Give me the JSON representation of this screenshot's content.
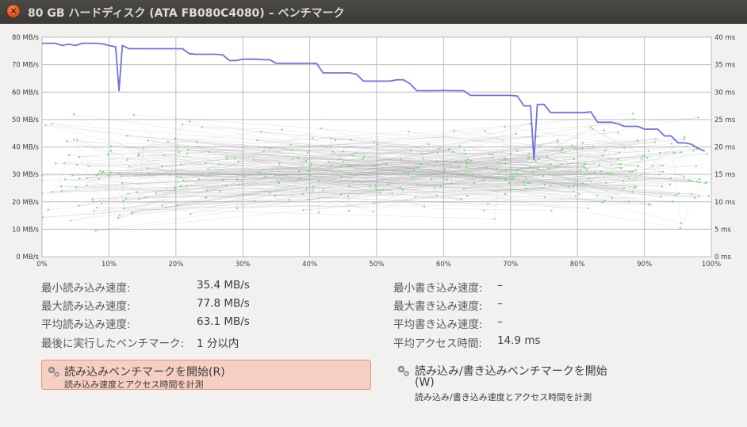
{
  "window": {
    "title": "80 GB ハードディスク (ATA FB080C4080) – ベンチマーク",
    "close_icon": "×"
  },
  "chart_data": {
    "type": "line",
    "y_left_ticks": [
      "0 MB/s",
      "10 MB/s",
      "20 MB/s",
      "30 MB/s",
      "40 MB/s",
      "50 MB/s",
      "60 MB/s",
      "70 MB/s",
      "80 MB/s"
    ],
    "y_right_ticks": [
      "0 ms",
      "5 ms",
      "10 ms",
      "15 ms",
      "20 ms",
      "25 ms",
      "30 ms",
      "35 ms",
      "40 ms"
    ],
    "x_ticks": [
      "0%",
      "10%",
      "20%",
      "30%",
      "40%",
      "50%",
      "60%",
      "70%",
      "80%",
      "90%",
      "100%"
    ],
    "ylim_left": [
      0,
      80
    ],
    "ylim_right": [
      0,
      40
    ],
    "xlim": [
      0,
      100
    ],
    "grid": true,
    "read_rate_color": "#7070e0",
    "access_time_color": "#6ee06e",
    "series": [
      {
        "values_x": [
          0,
          2,
          3,
          4,
          5,
          6,
          7,
          8,
          9,
          10,
          11,
          11.5,
          12,
          13,
          14,
          15,
          16,
          17,
          18,
          19,
          20,
          21,
          22,
          23,
          24,
          25,
          26,
          27,
          28,
          29,
          30,
          31,
          32,
          33,
          34,
          35,
          36,
          37,
          38,
          39,
          40,
          41,
          42,
          43,
          44,
          45,
          46,
          47,
          48,
          49,
          50,
          51,
          52,
          53,
          54,
          55,
          56,
          57,
          58,
          59,
          60,
          61,
          62,
          63,
          64,
          65,
          66,
          67,
          68,
          69,
          70,
          71,
          72,
          73,
          73.5,
          74,
          75,
          76,
          77,
          78,
          79,
          80,
          81,
          82,
          83,
          84,
          85,
          86,
          87,
          88,
          89,
          90,
          91,
          92,
          93,
          94,
          95,
          96,
          97,
          98,
          99
        ],
        "values_y": [
          77.8,
          77.8,
          77,
          77.5,
          77,
          77.8,
          77.8,
          77.8,
          77.6,
          77,
          76.5,
          60.5,
          77,
          75.8,
          75.8,
          75.8,
          75.8,
          75.8,
          75.8,
          75.8,
          75.8,
          75.8,
          74,
          73.8,
          73.8,
          73.8,
          73.8,
          73.6,
          71.5,
          71.5,
          72,
          72,
          72,
          71.8,
          71.8,
          70.5,
          70.5,
          70.5,
          70.5,
          70.5,
          70.5,
          70.5,
          67,
          67,
          67,
          67,
          67,
          66.5,
          64,
          64,
          64,
          64,
          64,
          64.5,
          64.5,
          63,
          60.5,
          60.5,
          60.5,
          60.5,
          60.6,
          60.5,
          60.5,
          60.5,
          58.8,
          58.8,
          58.8,
          58.8,
          58.8,
          58.8,
          58.8,
          58.6,
          55,
          55,
          35.4,
          55.5,
          55.5,
          52.5,
          52.5,
          52.5,
          52.5,
          52.5,
          52.5,
          52.8,
          49,
          49,
          49,
          48.5,
          47.5,
          47.5,
          47.5,
          46.5,
          46.5,
          46.5,
          44,
          44,
          41.5,
          41.5,
          41,
          39.5,
          38.5,
          38.5
        ]
      }
    ]
  },
  "stats": {
    "min_read_label": "最小読み込み速度:",
    "min_read_value": "35.4 MB/s",
    "max_read_label": "最大読み込み速度:",
    "max_read_value": "77.8 MB/s",
    "avg_read_label": "平均読み込み速度:",
    "avg_read_value": "63.1 MB/s",
    "last_run_label": "最後に実行したベンチマーク:",
    "last_run_value": "1 分以内",
    "min_write_label": "最小書き込み速度:",
    "min_write_value": "–",
    "max_write_label": "最大書き込み速度:",
    "max_write_value": "–",
    "avg_write_label": "平均書き込み速度:",
    "avg_write_value": "–",
    "avg_access_label": "平均アクセス時間:",
    "avg_access_value": "14.9 ms"
  },
  "buttons": {
    "read_bench_title": "読み込みベンチマークを開始(R)",
    "read_bench_sub": "読み込み速度とアクセス時間を計測",
    "rw_bench_title_line1": "読み込み/書き込みベンチマークを開始",
    "rw_bench_title_line2": "(W)",
    "rw_bench_sub": "読み込み/書き込み速度とアクセス時間を計測",
    "icon": "gears-icon"
  }
}
